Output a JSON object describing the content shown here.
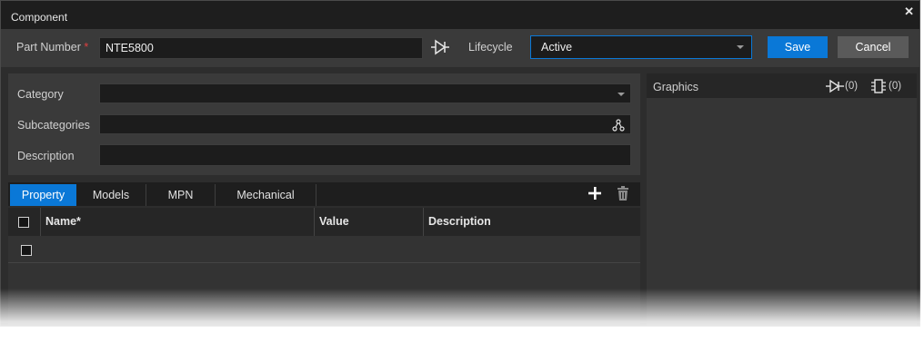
{
  "window": {
    "title": "Component",
    "close_glyph": "✕"
  },
  "header": {
    "part_number_label": "Part Number",
    "required_mark": "*",
    "part_number_value": "NTE5800",
    "lifecycle_label": "Lifecycle",
    "lifecycle_value": "Active",
    "save_label": "Save",
    "cancel_label": "Cancel"
  },
  "details": {
    "category_label": "Category",
    "category_value": "",
    "subcategories_label": "Subcategories",
    "subcategories_value": "",
    "description_label": "Description",
    "description_value": ""
  },
  "tabs": [
    {
      "label": "Property",
      "active": true
    },
    {
      "label": "Models",
      "active": false
    },
    {
      "label": "MPN",
      "active": false
    },
    {
      "label": "Mechanical",
      "active": false
    }
  ],
  "grid": {
    "columns": [
      "Name*",
      "Value",
      "Description"
    ],
    "rows": [
      {
        "name": "",
        "value": "",
        "description": ""
      }
    ]
  },
  "graphics": {
    "label": "Graphics",
    "symbol_count": "(0)",
    "footprint_count": "(0)"
  },
  "colors": {
    "accent": "#0a78d7",
    "background": "#2d2d2d",
    "panel": "#3a3a3a",
    "required": "#e04040"
  }
}
